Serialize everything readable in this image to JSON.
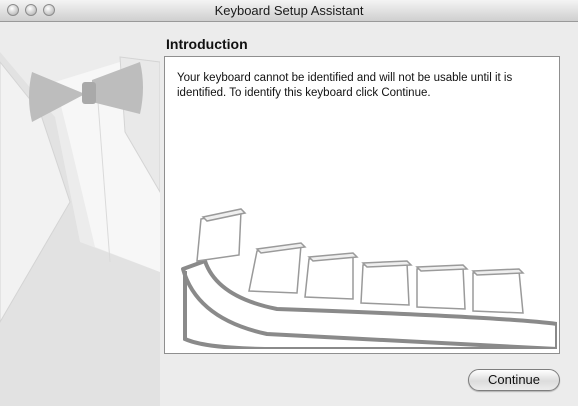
{
  "window": {
    "title": "Keyboard Setup Assistant"
  },
  "content": {
    "section_title": "Introduction",
    "message": "Your keyboard cannot be identified and will not be usable until it is identified. To identify this keyboard click Continue."
  },
  "footer": {
    "continue_label": "Continue"
  },
  "icons": {
    "side_art": "tuxedo-bowtie-illustration",
    "keyboard_art": "keyboard-illustration"
  },
  "colors": {
    "window_bg": "#ececec",
    "content_bg": "#ffffff",
    "art_gray": "#bdbdbd"
  }
}
